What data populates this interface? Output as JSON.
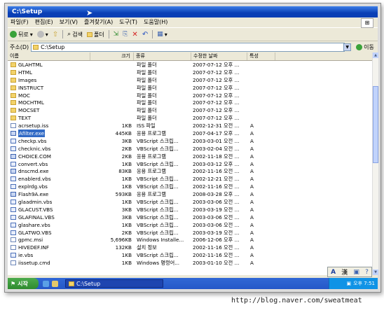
{
  "window": {
    "title": "C:\\Setup"
  },
  "menu": [
    "파일(F)",
    "편집(E)",
    "보기(V)",
    "즐겨찾기(A)",
    "도구(T)",
    "도움말(H)"
  ],
  "toolbar": {
    "back": "뒤로",
    "search": "검색",
    "folders": "폴더",
    "views_icon": "views-icon"
  },
  "address": {
    "label": "주소(D)",
    "value": "C:\\Setup",
    "go": "이동"
  },
  "columns": {
    "name": "이름",
    "size": "크기",
    "type": "종류",
    "modified": "수정한 날짜",
    "attr": "특성"
  },
  "files": [
    {
      "name": "GLAHTML",
      "size": "",
      "type": "파일 폴더",
      "modified": "2007-07-12 오후 ...",
      "attr": "",
      "icon": "folder"
    },
    {
      "name": "HTML",
      "size": "",
      "type": "파일 폴더",
      "modified": "2007-07-12 오후 ...",
      "attr": "",
      "icon": "folder"
    },
    {
      "name": "Images",
      "size": "",
      "type": "파일 폴더",
      "modified": "2007-07-12 오후 ...",
      "attr": "",
      "icon": "folder"
    },
    {
      "name": "INSTRUCT",
      "size": "",
      "type": "파일 폴더",
      "modified": "2007-07-12 오후 ...",
      "attr": "",
      "icon": "folder"
    },
    {
      "name": "MOC",
      "size": "",
      "type": "파일 폴더",
      "modified": "2007-07-12 오후 ...",
      "attr": "",
      "icon": "folder"
    },
    {
      "name": "MOCHTML",
      "size": "",
      "type": "파일 폴더",
      "modified": "2007-07-12 오후 ...",
      "attr": "",
      "icon": "folder"
    },
    {
      "name": "MOCSET",
      "size": "",
      "type": "파일 폴더",
      "modified": "2007-07-12 오후 ...",
      "attr": "",
      "icon": "folder"
    },
    {
      "name": "TEXT",
      "size": "",
      "type": "파일 폴더",
      "modified": "2007-07-12 오후 ...",
      "attr": "",
      "icon": "folder"
    },
    {
      "name": "acrsetup.iss",
      "size": "1KB",
      "type": "ISS 파일",
      "modified": "2002-12-31 오전 ...",
      "attr": "A",
      "icon": "file"
    },
    {
      "name": "Afilter.exe",
      "size": "445KB",
      "type": "응용 프로그램",
      "modified": "2007-04-17 오후 ...",
      "attr": "A",
      "icon": "exe",
      "selected": true
    },
    {
      "name": "checkp.vbs",
      "size": "3KB",
      "type": "VBScript 스크립...",
      "modified": "2003-03-01 오전 ...",
      "attr": "A",
      "icon": "script"
    },
    {
      "name": "checknic.vbs",
      "size": "2KB",
      "type": "VBScript 스크립...",
      "modified": "2003-02-04 오전 ...",
      "attr": "A",
      "icon": "script"
    },
    {
      "name": "CHOICE.COM",
      "size": "2KB",
      "type": "응용 프로그램",
      "modified": "2002-11-18 오전 ...",
      "attr": "A",
      "icon": "exe"
    },
    {
      "name": "convert.vbs",
      "size": "1KB",
      "type": "VBScript 스크립...",
      "modified": "2003-03-12 오후 ...",
      "attr": "A",
      "icon": "script"
    },
    {
      "name": "dnscmd.exe",
      "size": "83KB",
      "type": "응용 프로그램",
      "modified": "2002-11-16 오전 ...",
      "attr": "A",
      "icon": "exe"
    },
    {
      "name": "enablerd.vbs",
      "size": "1KB",
      "type": "VBScript 스크립...",
      "modified": "2002-12-21 오전 ...",
      "attr": "A",
      "icon": "script"
    },
    {
      "name": "explrdg.vbs",
      "size": "1KB",
      "type": "VBScript 스크립...",
      "modified": "2002-11-16 오전 ...",
      "attr": "A",
      "icon": "script"
    },
    {
      "name": "Flash9A.exe",
      "size": "593KB",
      "type": "응용 프로그램",
      "modified": "2008-03-28 오후 ...",
      "attr": "A",
      "icon": "exe"
    },
    {
      "name": "glaadmin.vbs",
      "size": "1KB",
      "type": "VBScript 스크립...",
      "modified": "2003-03-06 오전 ...",
      "attr": "A",
      "icon": "script"
    },
    {
      "name": "GLACUST.VBS",
      "size": "3KB",
      "type": "VBScript 스크립...",
      "modified": "2003-03-19 오전 ...",
      "attr": "A",
      "icon": "script"
    },
    {
      "name": "GLAFINAL.VBS",
      "size": "3KB",
      "type": "VBScript 스크립...",
      "modified": "2003-03-06 오전 ...",
      "attr": "A",
      "icon": "script"
    },
    {
      "name": "glashare.vbs",
      "size": "1KB",
      "type": "VBScript 스크립...",
      "modified": "2003-03-06 오전 ...",
      "attr": "A",
      "icon": "script"
    },
    {
      "name": "GLATWO.VBS",
      "size": "2KB",
      "type": "VBScript 스크립...",
      "modified": "2003-03-19 오전 ...",
      "attr": "A",
      "icon": "script"
    },
    {
      "name": "gpmc.msi",
      "size": "5,696KB",
      "type": "Windows Installe...",
      "modified": "2006-12-06 오후 ...",
      "attr": "A",
      "icon": "file"
    },
    {
      "name": "HIVEDEF.INF",
      "size": "132KB",
      "type": "설치 정보",
      "modified": "2002-11-16 오전 ...",
      "attr": "A",
      "icon": "file"
    },
    {
      "name": "ie.vbs",
      "size": "1KB",
      "type": "VBScript 스크립...",
      "modified": "2002-11-16 오전 ...",
      "attr": "A",
      "icon": "script"
    },
    {
      "name": "iissetup.cmd",
      "size": "1KB",
      "type": "Windows 명령어...",
      "modified": "2003-01-10 오전 ...",
      "attr": "A",
      "icon": "file"
    }
  ],
  "ime": {
    "lang": "A",
    "hanja": "漢"
  },
  "taskbar": {
    "start": "시작",
    "task": "C:\\Setup",
    "clock": "오후 7:51"
  },
  "caption": "http://blog.naver.com/sweatmeat",
  "colors": {
    "titlebar": "#0a3fb5",
    "selection": "#316ac5",
    "start": "#2e8b2e",
    "taskbar": "#2457c8"
  }
}
